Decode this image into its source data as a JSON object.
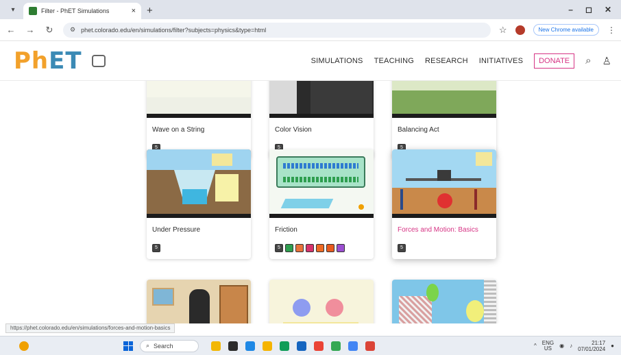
{
  "browser": {
    "tab_title": "Filter - PhET Simulations",
    "tab_close": "×",
    "new_tab": "+",
    "window_controls": {
      "minimize": "–",
      "maximize": "◻",
      "close": "✕"
    },
    "url": "phet.colorado.edu/en/simulations/filter?subjects=physics&type=html",
    "update_button": "New Chrome available",
    "status_url": "https://phet.colorado.edu/en/simulations/forces-and-motion-basics"
  },
  "site": {
    "logo_ph": "Ph",
    "logo_et": "ET",
    "nav": [
      "SIMULATIONS",
      "TEACHING",
      "RESEARCH",
      "INITIATIVES"
    ],
    "donate": "DONATE"
  },
  "cards": [
    {
      "title": "Wave on a String",
      "highlighted": false,
      "formats": [
        {
          "label": "5",
          "color": "#444444"
        }
      ]
    },
    {
      "title": "Color Vision",
      "highlighted": false,
      "formats": [
        {
          "label": "5",
          "color": "#444444"
        }
      ]
    },
    {
      "title": "Balancing Act",
      "highlighted": false,
      "formats": [
        {
          "label": "5",
          "color": "#444444"
        }
      ]
    },
    {
      "title": "Under Pressure",
      "highlighted": false,
      "formats": [
        {
          "label": "5",
          "color": "#444444"
        }
      ]
    },
    {
      "title": "Friction",
      "highlighted": false,
      "formats": [
        {
          "label": "5",
          "color": "#444444"
        },
        {
          "label": "",
          "color": "#2e9e4f"
        },
        {
          "label": "",
          "color": "#e8713a"
        },
        {
          "label": "",
          "color": "#d6336c"
        },
        {
          "label": "",
          "color": "#ee6a24"
        },
        {
          "label": "",
          "color": "#e85a1f"
        },
        {
          "label": "",
          "color": "#9b4fd1"
        }
      ]
    },
    {
      "title": "Forces and Motion: Basics",
      "highlighted": true,
      "formats": [
        {
          "label": "5",
          "color": "#444444"
        }
      ]
    },
    {
      "title": "",
      "highlighted": false,
      "formats": []
    },
    {
      "title": "",
      "highlighted": false,
      "formats": []
    },
    {
      "title": "",
      "highlighted": false,
      "formats": []
    }
  ],
  "taskbar": {
    "search_placeholder": "Search",
    "apps": [
      "#f2b705",
      "#2b2b2b",
      "#1e88e5",
      "#f5b400",
      "#0f9d58",
      "#1565c0",
      "#ea4335",
      "#34a853",
      "#4285f4",
      "#db4437"
    ],
    "lang_top": "ENG",
    "lang_bottom": "US",
    "time": "21:17",
    "date": "07/01/2024"
  }
}
